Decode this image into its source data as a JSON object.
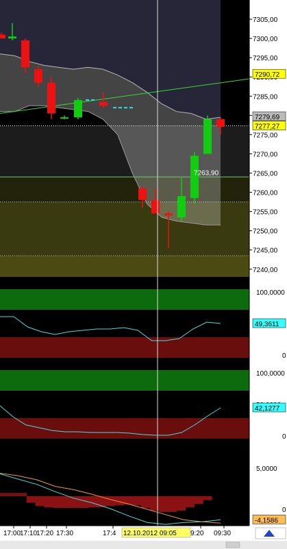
{
  "chart_data": [
    {
      "type": "candlestick",
      "ylim": [
        7238,
        7310
      ],
      "y_ticks": [
        7305,
        7300,
        7295,
        7290,
        7285,
        7280,
        7275,
        7270,
        7265,
        7260,
        7255,
        7250,
        7245,
        7240
      ],
      "y_tick_labels": [
        "7305,00",
        "7300,00",
        "7295,00",
        "7290,00",
        "7285,00",
        "7280,00",
        "7275,00",
        "7270,00",
        "7265,00",
        "7260,00",
        "7255,00",
        "7250,00",
        "7245,00",
        "7240,00"
      ],
      "candles": [
        {
          "open": 7301.0,
          "high": 7301.5,
          "low": 7300.0,
          "close": 7300.0
        },
        {
          "open": 7300.0,
          "high": 7304.0,
          "low": 7299.5,
          "close": 7300.5
        },
        {
          "open": 7299.5,
          "high": 7300.0,
          "low": 7291.0,
          "close": 7292.5
        },
        {
          "open": 7292.0,
          "high": 7293.0,
          "low": 7287.5,
          "close": 7288.5
        },
        {
          "open": 7288.5,
          "high": 7290.0,
          "low": 7279.0,
          "close": 7280.5
        },
        {
          "open": 7279.5,
          "high": 7280.0,
          "low": 7279.0,
          "close": 7279.5
        },
        {
          "open": 7279.5,
          "high": 7284.5,
          "low": 7279.0,
          "close": 7284.0
        },
        {
          "open": 7283.5,
          "high": 7286.0,
          "low": 7282.0,
          "close": 7282.5
        },
        {
          "open": 7261.0,
          "high": 7261.5,
          "low": 7256.0,
          "close": 7258.0
        },
        {
          "open": 7258.0,
          "high": 7261.0,
          "low": 7254.5,
          "close": 7254.5
        },
        {
          "open": 7254.5,
          "high": 7255.0,
          "low": 7245.5,
          "close": 7254.0
        },
        {
          "open": 7253.5,
          "high": 7264.0,
          "low": 7252.5,
          "close": 7259.0
        },
        {
          "open": 7258.5,
          "high": 7270.5,
          "low": 7257.0,
          "close": 7269.5
        },
        {
          "open": 7270.0,
          "high": 7280.0,
          "low": 7270.0,
          "close": 7279.0
        },
        {
          "open": 7279.0,
          "high": 7279.5,
          "low": 7275.0,
          "close": 7277.0
        }
      ],
      "price_labels": [
        {
          "text": "7290,72",
          "value": 7290.72,
          "style": "yellow"
        },
        {
          "text": "7279,69",
          "value": 7279.69,
          "style": "gray"
        },
        {
          "text": "7277,27",
          "value": 7277.27,
          "style": "yellow"
        },
        {
          "text": "7263,90",
          "value": 7263.9,
          "style": "plain"
        }
      ],
      "horizontal_levels": [
        7277.3,
        7264.0,
        7257.5,
        7243.5
      ],
      "trendline": {
        "start": 7280.5,
        "end": 7289.5
      },
      "dash_levels": [
        7284.0,
        7282.0
      ],
      "channel_upper": [
        7310.0,
        7310.0,
        7310.0,
        7310.0,
        7310.0,
        7310.0,
        7310.0,
        7310.0,
        7310.0,
        7310.0,
        7310.0,
        7310.0,
        7310.0,
        7310.0,
        7310.0,
        7310.0
      ],
      "channel_middle": [
        7296.0,
        7295.5,
        7294.0,
        7293.0,
        7292.5,
        7292.0,
        7292.5,
        7292.0,
        7290.5,
        7288.5,
        7286.0,
        7283.0,
        7281.0,
        7280.5,
        7279.0,
        7279.5
      ],
      "channel_lower": [
        7281.0,
        7281.0,
        7282.5,
        7282.5,
        7282.0,
        7281.5,
        7281.0,
        7279.0,
        7275.0,
        7265.0,
        7257.0,
        7253.5,
        7252.5,
        7252.0,
        7251.5,
        7251.5
      ]
    },
    {
      "type": "line",
      "ylim": [
        0,
        100
      ],
      "y_tick_labels": [
        "100,0000",
        "0"
      ],
      "current_value_label": "49,3611",
      "values": [
        60,
        60,
        45,
        38,
        34,
        38,
        40,
        42,
        42,
        44,
        40,
        25,
        25,
        28,
        42,
        52,
        50
      ]
    },
    {
      "type": "line",
      "ylim": [
        0,
        100
      ],
      "y_tick_labels": [
        "100,0000",
        "50,0000",
        "0"
      ],
      "current_value_label": "42,1277",
      "values": [
        48,
        32,
        20,
        16,
        12,
        10,
        10,
        9,
        9,
        9,
        8,
        6,
        5,
        5,
        9,
        20,
        33,
        45
      ]
    },
    {
      "type": "line",
      "ylim": [
        -4.5,
        7
      ],
      "y_tick_labels": [
        "5,0000",
        "0"
      ],
      "current_value_label": "-4,1586",
      "histogram": [
        0.5,
        0.5,
        0.5,
        -1.0,
        -1.5,
        -1.7,
        -1.8,
        -1.8,
        -1.8,
        -1.8,
        -1.7,
        -1.7,
        -1.5,
        -1.4,
        -1.3,
        -1.4,
        -1.8,
        -2.2,
        -2.4,
        -2.4,
        -2.2,
        -1.7,
        -1.2,
        -0.6,
        0
      ],
      "series": [
        {
          "values": [
            3.4,
            2.6,
            1.8,
            0.7,
            -0.3,
            -1.0,
            -1.9,
            -3.0,
            -4.0,
            -4.3,
            -4.0,
            -3.9,
            -3.6
          ]
        },
        {
          "values": [
            3.5,
            3.1,
            2.5,
            1.5,
            1.0,
            0.3,
            -0.5,
            -1.2,
            -2.0,
            -2.8,
            -3.6,
            -3.9,
            -4.1
          ]
        }
      ],
      "x_tick_labels": [
        "17:00",
        "17:10",
        "17:20",
        "17:30",
        "17:4",
        "9:20",
        "09:30"
      ],
      "cursor_time_label": "12.10.2012 09:05"
    }
  ]
}
